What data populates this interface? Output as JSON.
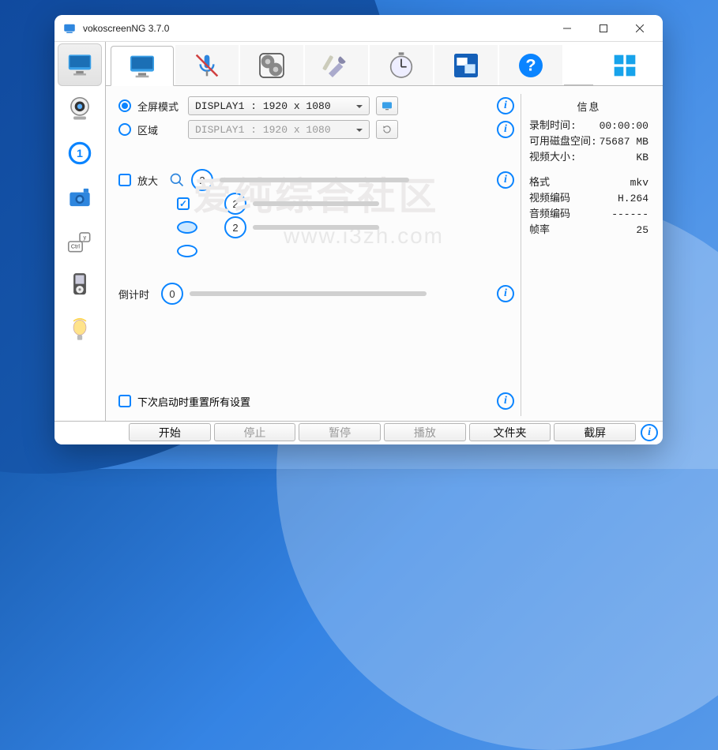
{
  "window": {
    "title": "vokoscreenNG 3.7.0"
  },
  "display": {
    "fullscreen_label": "全屏模式",
    "fullscreen_option": "DISPLAY1 :  1920 x 1080",
    "region_label": "区域",
    "region_option": "DISPLAY1 :  1920 x 1080"
  },
  "zoom": {
    "label": "放大",
    "v1": "2",
    "v2": "2",
    "v3": "2"
  },
  "countdown": {
    "label": "倒计时",
    "value": "0"
  },
  "reset": {
    "label": "下次启动时重置所有设置"
  },
  "info": {
    "title": "信息",
    "rec_time_label": "录制时间:",
    "rec_time_value": "00:00:00",
    "disk_label": "可用磁盘空间:",
    "disk_value": "75687 MB",
    "video_size_label": "视频大小:",
    "video_size_value": "KB",
    "format_label": "格式",
    "format_value": "mkv",
    "vcodec_label": "视频编码",
    "vcodec_value": "H.264",
    "acodec_label": "音频编码",
    "acodec_value": "------",
    "fps_label": "帧率",
    "fps_value": "25"
  },
  "buttons": {
    "start": "开始",
    "stop": "停止",
    "pause": "暂停",
    "play": "播放",
    "folder": "文件夹",
    "screenshot": "截屏"
  },
  "watermark": {
    "top": "爱纯综合社区",
    "bottom": "www.i3zh.com"
  }
}
